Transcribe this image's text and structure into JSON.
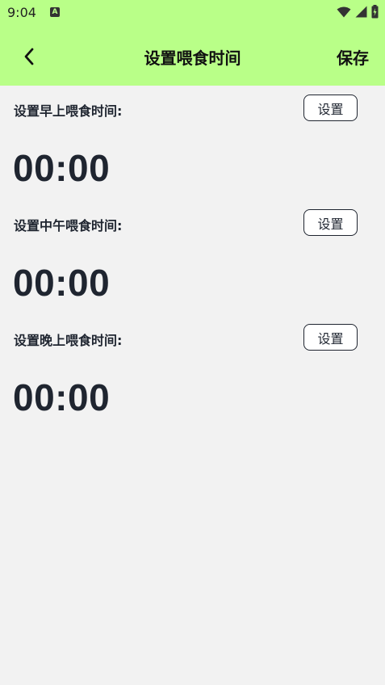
{
  "status_bar": {
    "time": "9:04",
    "notification_icon": "a-icon",
    "icons": [
      "wifi-icon",
      "cellular-signal-icon",
      "battery-icon"
    ]
  },
  "header": {
    "back_icon": "chevron-left-icon",
    "title": "设置喂食时间",
    "save_label": "保存"
  },
  "sections": [
    {
      "label": "设置早上喂食时间:",
      "button_label": "设置",
      "time": "00:00"
    },
    {
      "label": "设置中午喂食时间:",
      "button_label": "设置",
      "time": "00:00"
    },
    {
      "label": "设置晚上喂食时间:",
      "button_label": "设置",
      "time": "00:00"
    }
  ],
  "colors": {
    "header_background": "#b9ff88",
    "page_background": "#f2f2f2",
    "text": "#1f2530"
  }
}
